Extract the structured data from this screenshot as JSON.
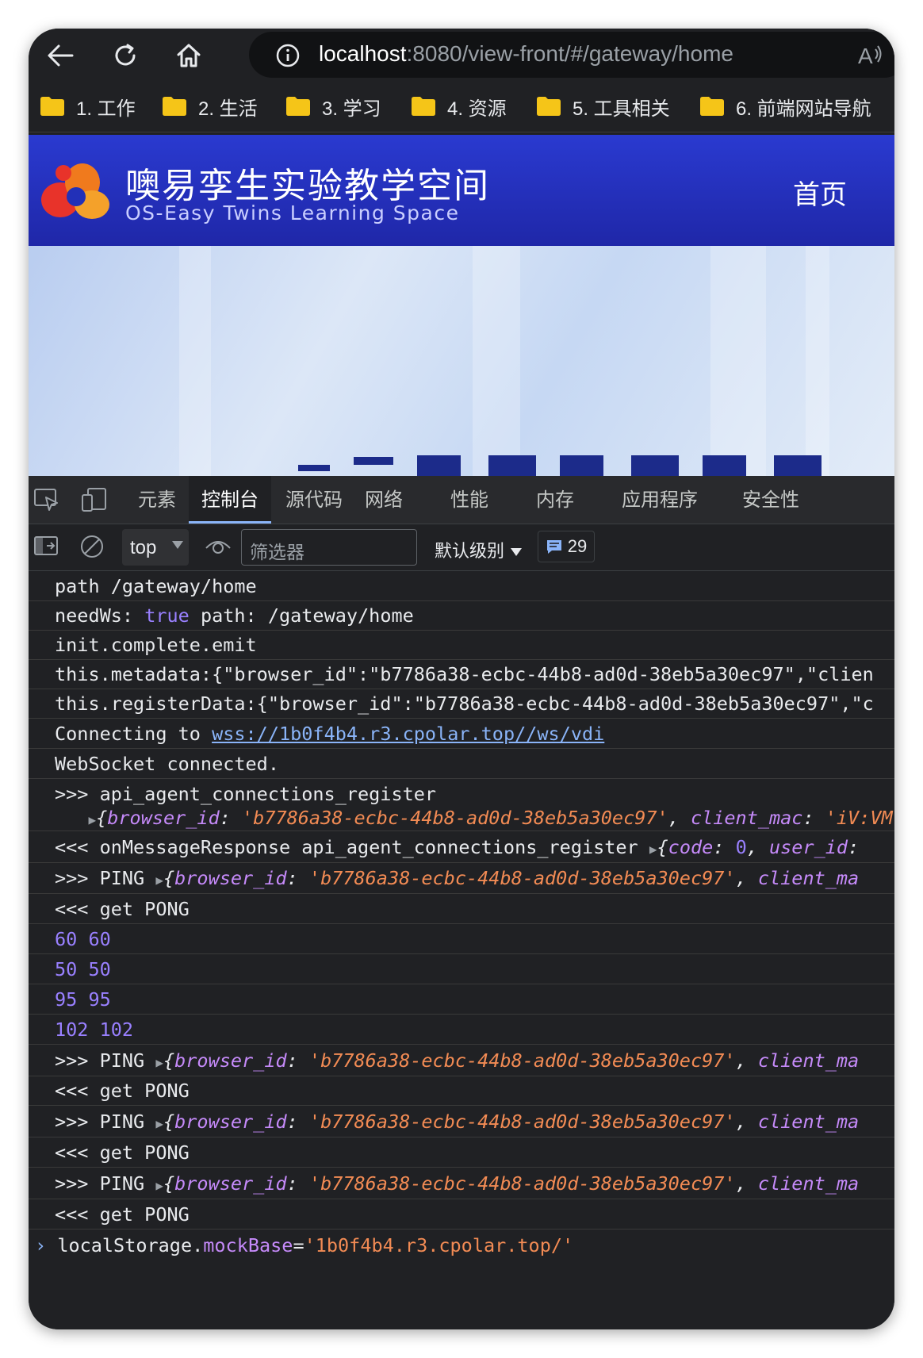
{
  "browser": {
    "url_host": "localhost",
    "url_rest": ":8080/view-front/#/gateway/home"
  },
  "bookmarks": [
    {
      "label": "1. 工作"
    },
    {
      "label": "2. 生活"
    },
    {
      "label": "3. 学习"
    },
    {
      "label": "4. 资源"
    },
    {
      "label": "5. 工具相关"
    },
    {
      "label": "6. 前端网站导航"
    }
  ],
  "site": {
    "title": "噢易孪生实验教学空间",
    "subtitle": "OS-Easy Twins Learning Space",
    "nav_home": "首页"
  },
  "devtools": {
    "tabs": [
      "元素",
      "控制台",
      "源代码",
      "网络",
      "性能",
      "内存",
      "应用程序",
      "安全性"
    ],
    "active_tab": "控制台",
    "context": "top",
    "filter_placeholder": "筛选器",
    "levels": "默认级别",
    "message_count": "29"
  },
  "console": {
    "lines": [
      "path /gateway/home",
      "needWs:",
      "true",
      "path: /gateway/home",
      "init.complete.emit",
      "this.metadata:{\"browser_id\":\"b7786a38-ecbc-44b8-ad0d-38eb5a30ec97\",\"clien",
      "this.registerData:{\"browser_id\":\"b7786a38-ecbc-44b8-ad0d-38eb5a30ec97\",\"c",
      "Connecting to",
      "wss://1b0f4b4.r3.cpolar.top//ws/vdi",
      "WebSocket connected.",
      ">>> api_agent_connections_register",
      "<<< onMessageResponse api_agent_connections_register",
      ">>> PING",
      "<<< get PONG"
    ],
    "obj_register": {
      "k1": "browser_id",
      "v1": "'b7786a38-ecbc-44b8-ad0d-38eb5a30ec97'",
      "k2": "client_mac",
      "v2": "'iV:VM"
    },
    "obj_response": {
      "k1": "code",
      "v1": "0",
      "k2": "user_id"
    },
    "obj_ping": {
      "k1": "browser_id",
      "v1": "'b7786a38-ecbc-44b8-ad0d-38eb5a30ec97'",
      "k2": "client_ma"
    },
    "numbers": [
      {
        "a": "60",
        "b": "60"
      },
      {
        "a": "50",
        "b": "50"
      },
      {
        "a": "95",
        "b": "95"
      },
      {
        "a": "102",
        "b": "102"
      }
    ],
    "prompt": {
      "obj": "localStorage.",
      "prop": "mockBase",
      "eq": "=",
      "value": "'1b0f4b4.r3.cpolar.top/'"
    }
  }
}
